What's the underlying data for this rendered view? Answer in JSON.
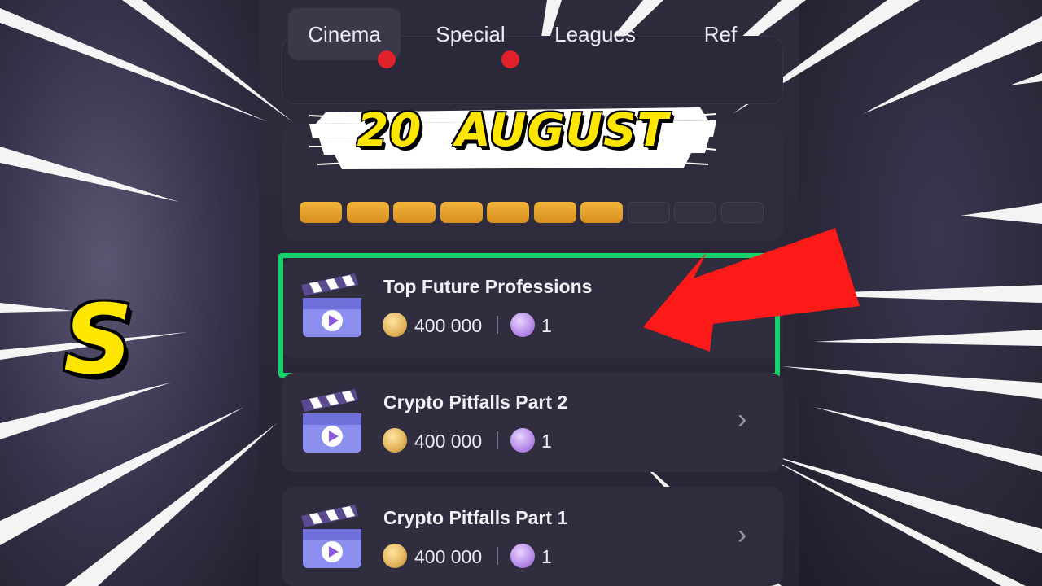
{
  "tabs": [
    {
      "label": "Cinema",
      "active": true,
      "badge": true
    },
    {
      "label": "Special",
      "active": false,
      "badge": true
    },
    {
      "label": "Leagues",
      "active": false,
      "badge": false
    },
    {
      "label": "Ref",
      "active": false,
      "badge": false
    }
  ],
  "banner": {
    "day": "20",
    "month": "AUGUST"
  },
  "progress": {
    "filled": 7,
    "total": 10
  },
  "overlay_letter": "S",
  "videos": [
    {
      "title": "Top Future Professions",
      "reward": "400 000",
      "tickets": "1",
      "highlighted": true
    },
    {
      "title": "Crypto Pitfalls Part 2",
      "reward": "400 000",
      "tickets": "1",
      "highlighted": false
    },
    {
      "title": "Crypto Pitfalls Part 1",
      "reward": "400 000",
      "tickets": "1",
      "highlighted": false
    }
  ],
  "colors": {
    "accent_gold": "#f2b33b",
    "highlight_green": "#12d36a",
    "arrow_red": "#ff1a1a",
    "banner_yellow": "#ffe600"
  }
}
